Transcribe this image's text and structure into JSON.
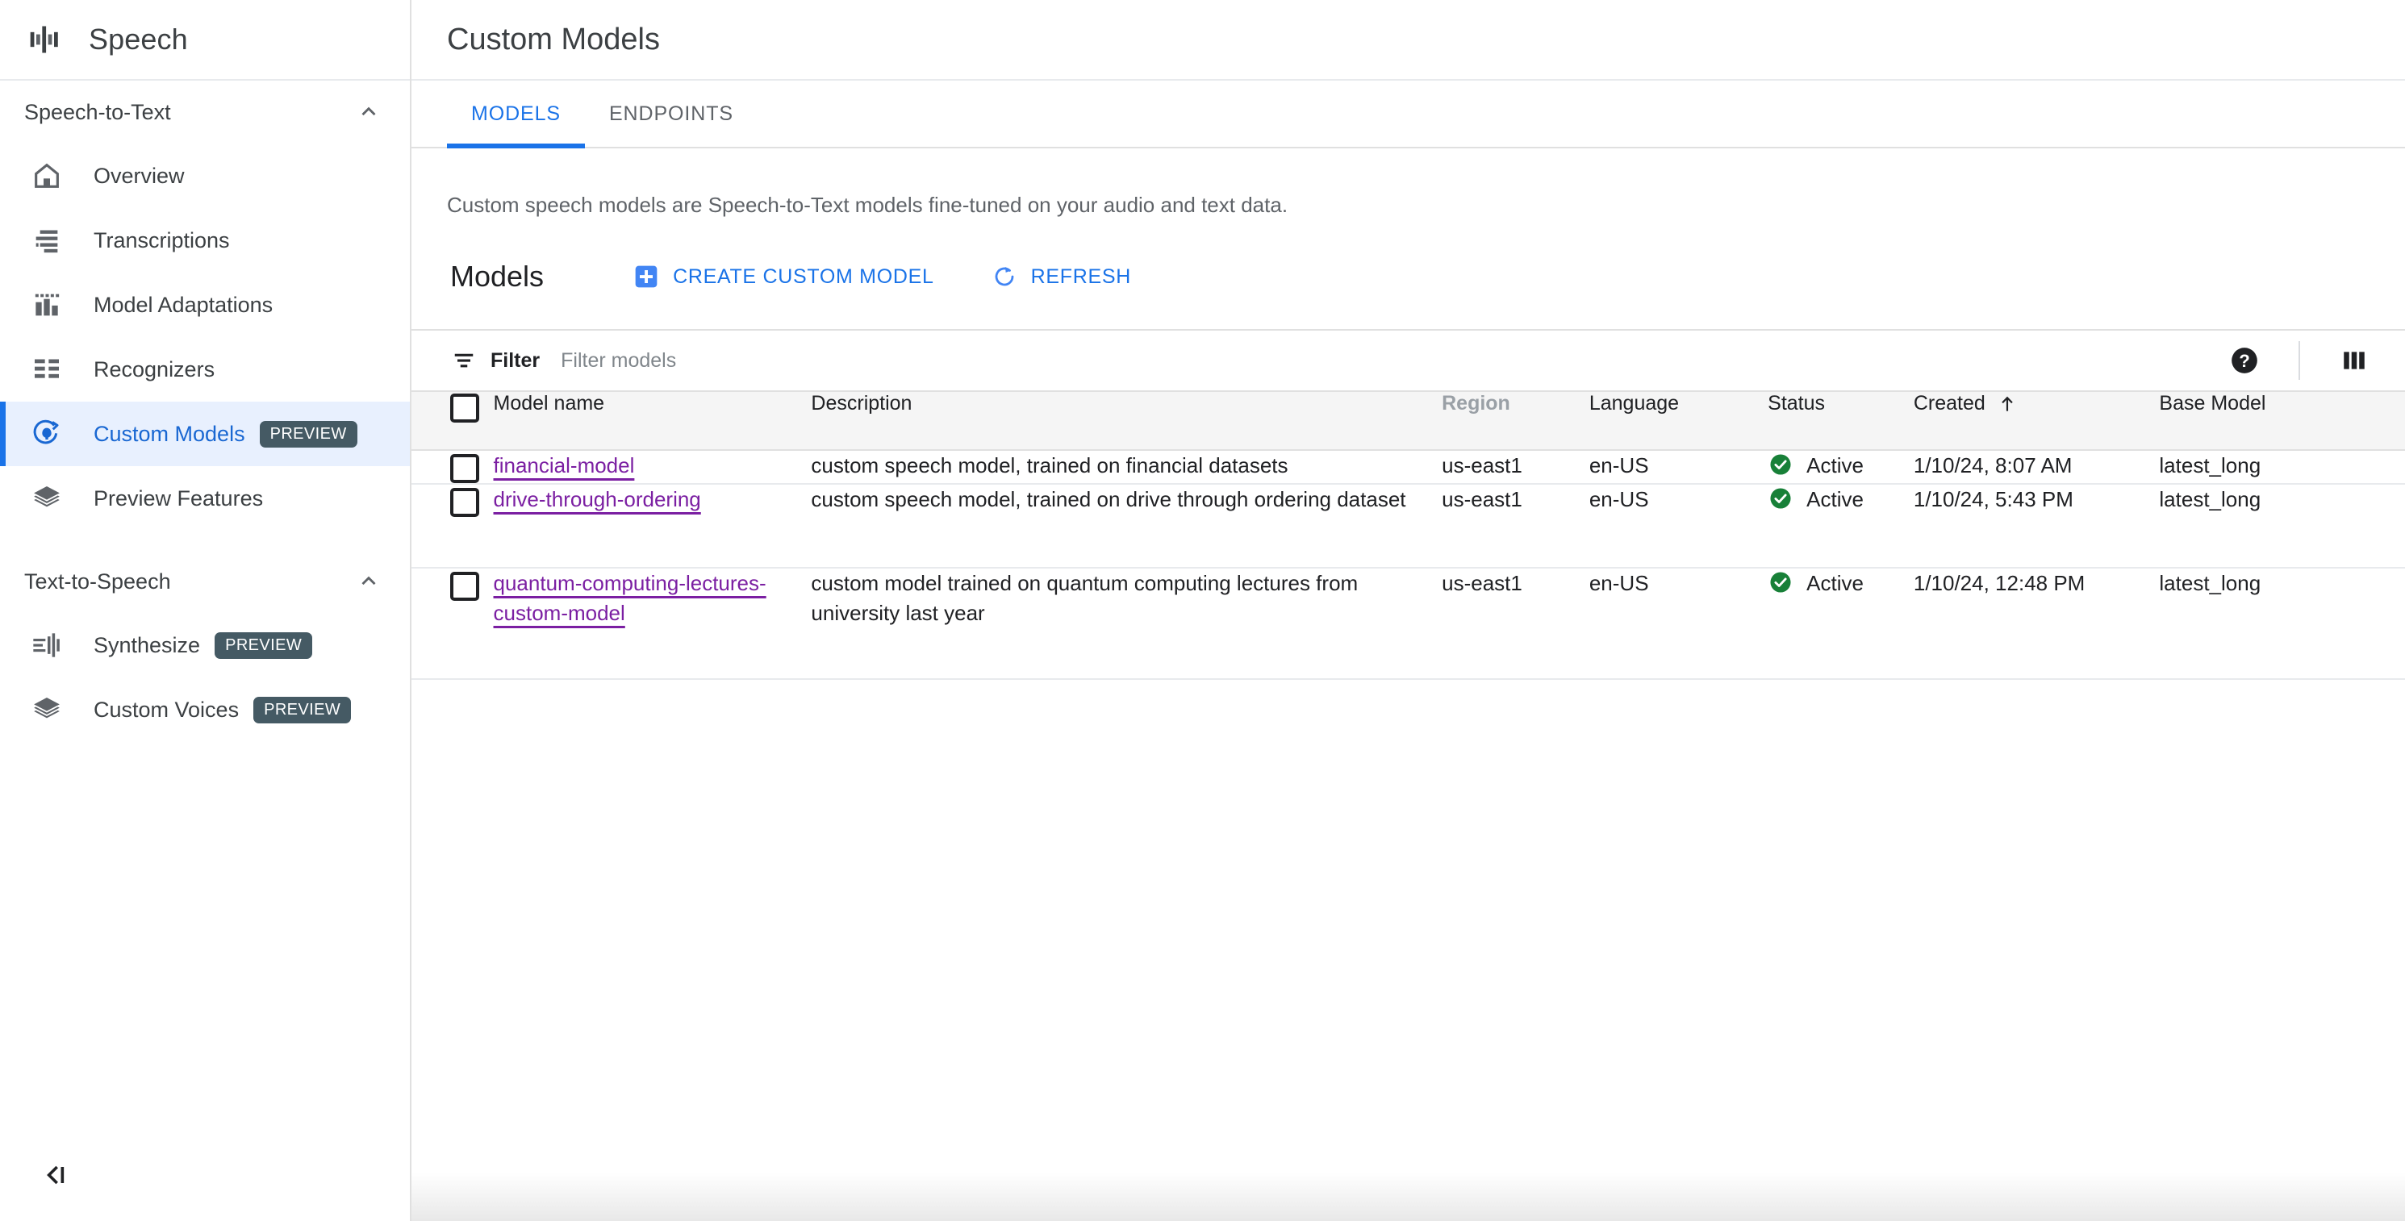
{
  "brand": {
    "title": "Speech",
    "icon": "audio-waveform-icon"
  },
  "sidebar": {
    "groups": [
      {
        "label": "Speech-to-Text",
        "expanded": true,
        "items": [
          {
            "label": "Overview",
            "icon": "home-icon",
            "badge": null,
            "active": false
          },
          {
            "label": "Transcriptions",
            "icon": "transcription-list-icon",
            "badge": null,
            "active": false
          },
          {
            "label": "Model Adaptations",
            "icon": "bar-chart-icon",
            "badge": null,
            "active": false
          },
          {
            "label": "Recognizers",
            "icon": "list-grid-icon",
            "badge": null,
            "active": false
          },
          {
            "label": "Custom Models",
            "icon": "custom-model-icon",
            "badge": "PREVIEW",
            "active": true
          },
          {
            "label": "Preview Features",
            "icon": "layers-icon",
            "badge": null,
            "active": false
          }
        ]
      },
      {
        "label": "Text-to-Speech",
        "expanded": true,
        "items": [
          {
            "label": "Synthesize",
            "icon": "synthesize-waveform-icon",
            "badge": "PREVIEW",
            "active": false
          },
          {
            "label": "Custom Voices",
            "icon": "layers-icon",
            "badge": "PREVIEW",
            "active": false
          }
        ]
      }
    ],
    "collapse_label": "collapse-sidebar-icon"
  },
  "header": {
    "title": "Custom Models"
  },
  "tabs": [
    {
      "label": "MODELS",
      "selected": true
    },
    {
      "label": "ENDPOINTS",
      "selected": false
    }
  ],
  "intro": "Custom speech models are Speech-to-Text models fine-tuned on your audio and text data.",
  "models_section": {
    "heading": "Models",
    "create_label": "CREATE CUSTOM MODEL",
    "refresh_label": "REFRESH"
  },
  "toolbar": {
    "filter_label": "Filter",
    "filter_placeholder": "Filter models",
    "filter_value": "",
    "help_icon": "help-circle-icon",
    "columns_icon": "column-display-options-icon"
  },
  "table": {
    "columns": [
      {
        "key": "checkbox",
        "label": ""
      },
      {
        "key": "name",
        "label": "Model name",
        "muted": false
      },
      {
        "key": "description",
        "label": "Description",
        "muted": false
      },
      {
        "key": "region",
        "label": "Region",
        "muted": true
      },
      {
        "key": "language",
        "label": "Language",
        "muted": false
      },
      {
        "key": "status",
        "label": "Status",
        "muted": false
      },
      {
        "key": "created",
        "label": "Created",
        "muted": false,
        "sorted": "asc"
      },
      {
        "key": "base_model",
        "label": "Base Model",
        "muted": false
      }
    ],
    "rows": [
      {
        "name": "financial-model",
        "description": "custom speech model, trained on financial datasets",
        "region": "us-east1",
        "language": "en-US",
        "status": "Active",
        "created": "1/10/24, 8:07 AM",
        "base_model": "latest_long"
      },
      {
        "name": "drive-through-ordering",
        "description": "custom speech model, trained on drive through ordering dataset",
        "region": "us-east1",
        "language": "en-US",
        "status": "Active",
        "created": "1/10/24, 5:43 PM",
        "base_model": "latest_long"
      },
      {
        "name": "quantum-computing-lectures-custom-model",
        "description": "custom model trained on quantum computing lectures from university last year",
        "region": "us-east1",
        "language": "en-US",
        "status": "Active",
        "created": "1/10/24, 12:48 PM",
        "base_model": "latest_long"
      }
    ]
  },
  "colors": {
    "accent_blue": "#1a73e8",
    "active_bg": "#e8f0fe",
    "link_purple": "#7b1fa2",
    "status_green": "#188038",
    "badge_bg": "#455a64",
    "muted_text": "#5f6368"
  }
}
